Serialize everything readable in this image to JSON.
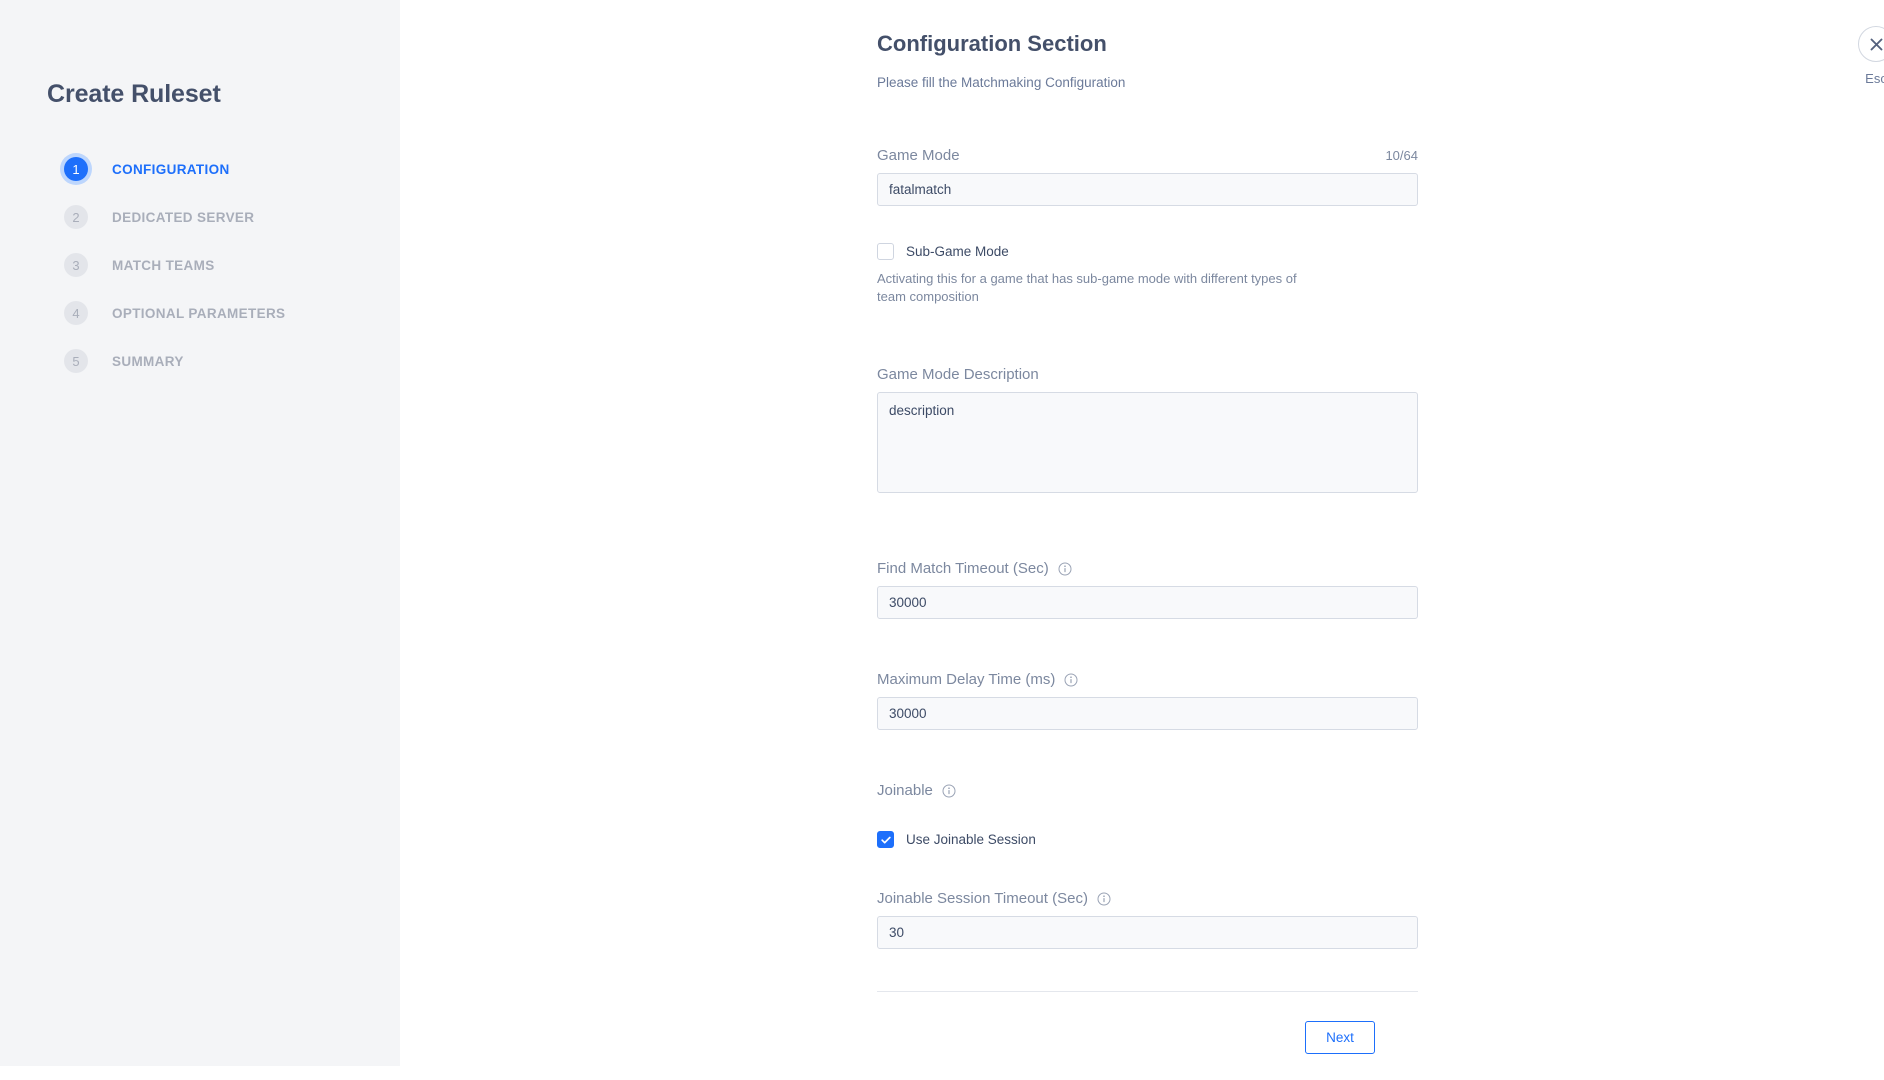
{
  "sidebar": {
    "title": "Create Ruleset",
    "steps": [
      {
        "number": "1",
        "label": "CONFIGURATION",
        "active": true
      },
      {
        "number": "2",
        "label": "DEDICATED SERVER",
        "active": false
      },
      {
        "number": "3",
        "label": "MATCH TEAMS",
        "active": false
      },
      {
        "number": "4",
        "label": "OPTIONAL PARAMETERS",
        "active": false
      },
      {
        "number": "5",
        "label": "SUMMARY",
        "active": false
      }
    ]
  },
  "header": {
    "title": "Configuration Section",
    "subtitle": "Please fill the Matchmaking Configuration"
  },
  "form": {
    "game_mode": {
      "label": "Game Mode",
      "counter": "10/64",
      "value": "fatalmatch",
      "placeholder": ""
    },
    "sub_game_mode": {
      "label": "Sub-Game Mode",
      "checked": false,
      "helper": "Activating this for a game that has sub-game mode with different types of team composition"
    },
    "game_mode_description": {
      "label": "Game Mode Description",
      "value": "description",
      "placeholder": ""
    },
    "find_match_timeout": {
      "label": "Find Match Timeout (Sec)",
      "value": "30000",
      "info_icon": "info-icon"
    },
    "maximum_delay_time": {
      "label": "Maximum Delay Time (ms)",
      "value": "30000",
      "info_icon": "info-icon"
    },
    "joinable": {
      "label": "Joinable",
      "info_icon": "info-icon",
      "checkbox_label": "Use Joinable Session",
      "checked": true
    },
    "joinable_session_timeout": {
      "label": "Joinable Session Timeout (Sec)",
      "value": "30",
      "info_icon": "info-icon"
    }
  },
  "footer": {
    "next_label": "Next"
  },
  "close": {
    "icon": "close-icon",
    "label": "Esc"
  },
  "colors": {
    "accent": "#1d6ffb",
    "sidebar_bg": "#f4f5f7",
    "label_text": "#7c889f",
    "heading_text": "#44506a",
    "input_bg": "#f8f9fb",
    "input_border": "#d6dbe4"
  }
}
